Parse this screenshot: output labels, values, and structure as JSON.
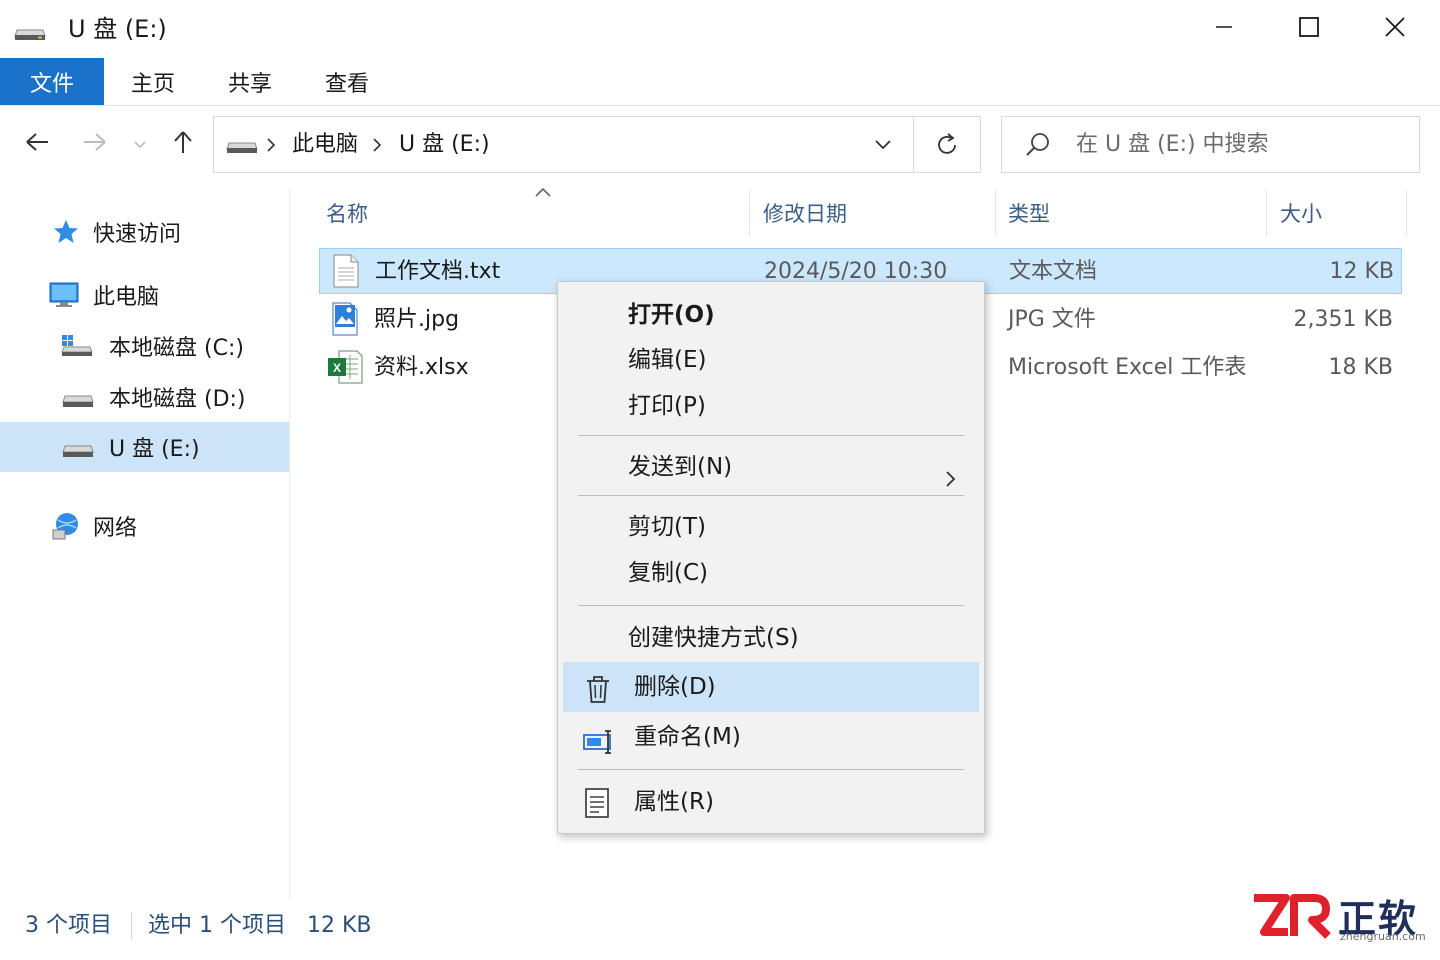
{
  "window": {
    "title": "U 盘 (E:)",
    "controls": [
      "minimize-icon",
      "maximize-icon",
      "close-icon"
    ]
  },
  "ribbon": {
    "tabs": [
      {
        "label": "文件",
        "active": true
      },
      {
        "label": "主页"
      },
      {
        "label": "共享"
      },
      {
        "label": "查看"
      }
    ]
  },
  "nav": {
    "breadcrumb": [
      "此电脑",
      "U 盘 (E:)"
    ],
    "search_placeholder": "在 U 盘 (E:) 中搜索"
  },
  "sidebar": {
    "items": [
      {
        "label": "快速访问",
        "icon": "star-icon"
      },
      {
        "label": "此电脑",
        "icon": "computer-icon"
      },
      {
        "label": "本地磁盘 (C:)",
        "icon": "windows-drive-icon"
      },
      {
        "label": "本地磁盘 (D:)",
        "icon": "drive-icon"
      },
      {
        "label": "U 盘 (E:)",
        "icon": "drive-icon",
        "selected": true
      },
      {
        "label": "网络",
        "icon": "network-icon"
      }
    ]
  },
  "columns": {
    "name": "名称",
    "modified": "修改日期",
    "type": "类型",
    "size": "大小"
  },
  "files": [
    {
      "name": "工作文档.txt",
      "modified": "2024/5/20 10:30",
      "type": "文本文档",
      "size": "12 KB",
      "icon": "text-file-icon",
      "selected": true
    },
    {
      "name": "照片.jpg",
      "modified": "",
      "type": "JPG 文件",
      "size": "2,351 KB",
      "icon": "image-file-icon"
    },
    {
      "name": "资料.xlsx",
      "modified": "",
      "type": "Microsoft Excel 工作表",
      "size": "18 KB",
      "icon": "excel-file-icon"
    }
  ],
  "context_menu": {
    "items": [
      {
        "label": "打开(O)",
        "bold": true
      },
      {
        "label": "编辑(E)"
      },
      {
        "label": "打印(P)"
      },
      {
        "label": "发送到(N)",
        "submenu": true
      },
      {
        "label": "剪切(T)"
      },
      {
        "label": "复制(C)"
      },
      {
        "label": "创建快捷方式(S)"
      },
      {
        "label": "删除(D)",
        "icon": "trash-icon",
        "hover": true
      },
      {
        "label": "重命名(M)",
        "icon": "rename-icon"
      },
      {
        "label": "属性(R)",
        "icon": "properties-icon"
      }
    ]
  },
  "status": {
    "count": "3 个项目",
    "selection": "选中 1 个项目",
    "selection_size": "12 KB"
  },
  "watermark": {
    "brand": "正软",
    "url": "zhengruan.com"
  },
  "colors": {
    "accent": "#1a73c9",
    "selection": "#cce8ff",
    "menu_hover": "#cce4f7",
    "watermark_red": "#e0202a"
  }
}
